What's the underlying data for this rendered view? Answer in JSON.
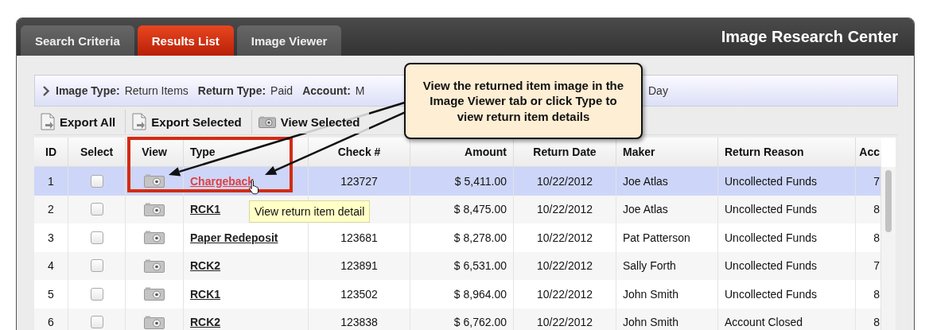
{
  "tabs": [
    {
      "label": "Search Criteria",
      "selected": false
    },
    {
      "label": "Results List",
      "selected": true
    },
    {
      "label": "Image Viewer",
      "selected": false
    }
  ],
  "window": {
    "title": "Image Research Center"
  },
  "filter": {
    "items": [
      {
        "label": "Image Type:",
        "value": "Return Items"
      },
      {
        "label": "Return Type:",
        "value": "Paid"
      },
      {
        "label": "Account:",
        "value": "M"
      }
    ],
    "trailing": "Day"
  },
  "toolbar": [
    {
      "label": "Export All",
      "kind": "export"
    },
    {
      "label": "Export Selected",
      "kind": "export"
    },
    {
      "label": "View Selected",
      "kind": "view"
    }
  ],
  "table": {
    "columns": [
      "ID",
      "Select",
      "View",
      "Type",
      "Check #",
      "Amount",
      "Return Date",
      "Maker",
      "Return Reason",
      "Acc"
    ],
    "rows": [
      {
        "id": "1",
        "checked": false,
        "type": "Chargeback",
        "check": "123727",
        "amount": "$ 5,411.00",
        "date": "10/22/2012",
        "maker": "Joe Atlas",
        "reason": "Uncollected Funds",
        "acc": "7",
        "selected": true,
        "hovered": true
      },
      {
        "id": "2",
        "checked": false,
        "type": "RCK1",
        "amount": "$ 8,475.00",
        "date": "10/22/2012",
        "maker": "Joe Atlas",
        "reason": "Uncollected Funds",
        "acc": "8",
        "selected": false,
        "hovered": false
      },
      {
        "id": "3",
        "checked": false,
        "type": "Paper Redeposit",
        "check": "123681",
        "amount": "$ 8,278.00",
        "date": "10/22/2012",
        "maker": "Pat Patterson",
        "reason": "Uncollected Funds",
        "acc": "8",
        "selected": false,
        "hovered": false
      },
      {
        "id": "4",
        "checked": false,
        "type": "RCK2",
        "check": "123891",
        "amount": "$ 6,531.00",
        "date": "10/22/2012",
        "maker": "Sally Forth",
        "reason": "Uncollected Funds",
        "acc": "7",
        "selected": false,
        "hovered": false
      },
      {
        "id": "5",
        "checked": false,
        "type": "RCK1",
        "check": "123502",
        "amount": "$ 8,964.00",
        "date": "10/22/2012",
        "maker": "John Smith",
        "reason": "Uncollected Funds",
        "acc": "8",
        "selected": false,
        "hovered": false
      },
      {
        "id": "6",
        "checked": false,
        "type": "RCK2",
        "check": "123838",
        "amount": "$ 6,762.00",
        "date": "10/22/2012",
        "maker": "John Smith",
        "reason": "Account Closed",
        "acc": "8",
        "selected": false,
        "hovered": false
      }
    ]
  },
  "tooltip": "View return item detail",
  "callout": "View the returned item image in the Image Viewer tab or click Type to view return item details"
}
